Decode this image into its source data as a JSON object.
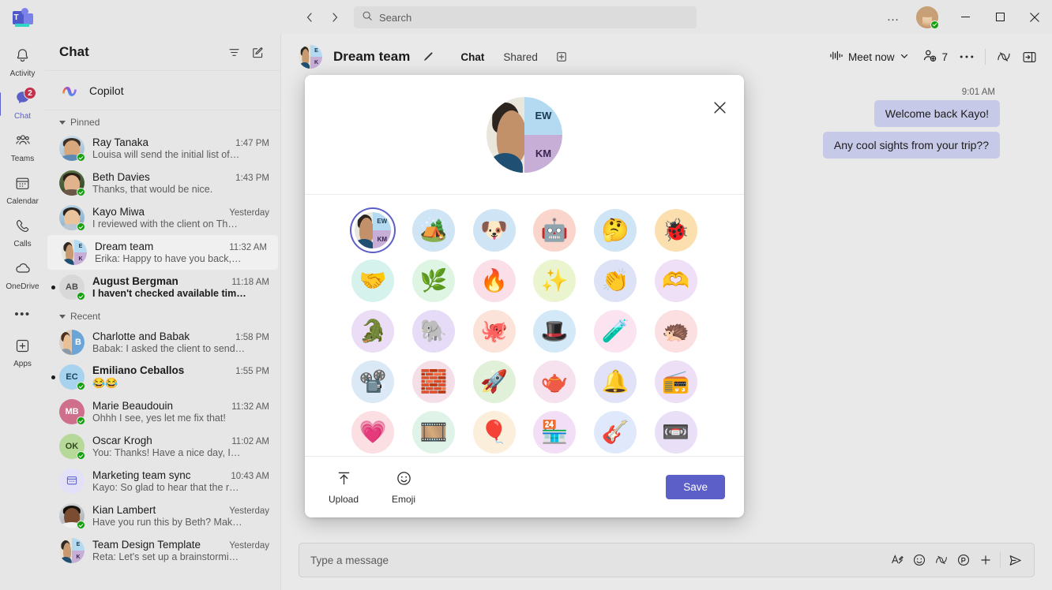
{
  "titlebar": {
    "app_name": "Microsoft Teams",
    "back_icon": "chevron-left-icon",
    "forward_icon": "chevron-right-icon",
    "search_placeholder": "Search",
    "search_value": "",
    "more_label": "…",
    "minimize_label": "–",
    "maximize_label": "☐",
    "close_label": "✕"
  },
  "rail": {
    "items": [
      {
        "label": "Activity",
        "icon": "bell-icon",
        "active": false,
        "badge": ""
      },
      {
        "label": "Chat",
        "icon": "chat-icon",
        "active": true,
        "badge": "2"
      },
      {
        "label": "Teams",
        "icon": "people-icon",
        "active": false,
        "badge": ""
      },
      {
        "label": "Calendar",
        "icon": "calendar-icon",
        "active": false,
        "badge": ""
      },
      {
        "label": "Calls",
        "icon": "phone-icon",
        "active": false,
        "badge": ""
      },
      {
        "label": "OneDrive",
        "icon": "cloud-icon",
        "active": false,
        "badge": ""
      }
    ],
    "more_label": "•••",
    "apps_label": "Apps",
    "apps_icon": "plus-box-icon"
  },
  "chat_list": {
    "title": "Chat",
    "filter_icon": "filter-icon",
    "compose_icon": "compose-icon",
    "copilot_label": "Copilot",
    "groups": [
      {
        "label": "Pinned",
        "items": [
          {
            "name": "Ray Tanaka",
            "time": "1:47 PM",
            "preview": "Louisa will send the initial list of…",
            "unread": false,
            "selected": false,
            "avatar_type": "photo",
            "initials": "RT",
            "color": "#a8c4d8",
            "presence": true
          },
          {
            "name": "Beth Davies",
            "time": "1:43 PM",
            "preview": "Thanks, that would be nice.",
            "unread": false,
            "selected": false,
            "avatar_type": "photo",
            "initials": "BD",
            "color": "#7f9f73",
            "presence": true
          },
          {
            "name": "Kayo Miwa",
            "time": "Yesterday",
            "preview": "I reviewed with the client on Th…",
            "unread": false,
            "selected": false,
            "avatar_type": "photo",
            "initials": "KM",
            "color": "#9fc3dd",
            "presence": true
          },
          {
            "name": "Dream team",
            "time": "11:32 AM",
            "preview": "Erika: Happy to have you back,…",
            "unread": false,
            "selected": true,
            "avatar_type": "group",
            "initials": "DT",
            "color": "#b4a7d6",
            "presence": false
          },
          {
            "name": "August Bergman",
            "time": "11:18 AM",
            "preview": "I haven't checked available tim…",
            "unread": true,
            "selected": false,
            "avatar_type": "initials",
            "initials": "AB",
            "color": "#d6d6d6",
            "presence": true
          }
        ]
      },
      {
        "label": "Recent",
        "items": [
          {
            "name": "Charlotte and Babak",
            "time": "1:58 PM",
            "preview": "Babak: I asked the client to send…",
            "unread": false,
            "selected": false,
            "avatar_type": "group2",
            "initials": "B",
            "color": "#6ba5d7",
            "presence": false
          },
          {
            "name": "Emiliano Ceballos",
            "time": "1:55 PM",
            "preview": "😂😂",
            "unread": true,
            "selected": false,
            "avatar_type": "initials",
            "initials": "EC",
            "color": "#a8d3ef",
            "presence": true
          },
          {
            "name": "Marie Beaudouin",
            "time": "11:32 AM",
            "preview": "Ohhh I see, yes let me fix that!",
            "unread": false,
            "selected": false,
            "avatar_type": "initials",
            "initials": "MB",
            "color": "#d9849c",
            "presence": true
          },
          {
            "name": "Oscar Krogh",
            "time": "11:02 AM",
            "preview": "You: Thanks! Have a nice day, I…",
            "unread": false,
            "selected": false,
            "avatar_type": "initials",
            "initials": "OK",
            "color": "#b6d99a",
            "presence": true
          },
          {
            "name": "Marketing team sync",
            "time": "10:43 AM",
            "preview": "Kayo: So glad to hear that the r…",
            "unread": false,
            "selected": false,
            "avatar_type": "meeting",
            "initials": "MS",
            "color": "#e3e1f7",
            "presence": false
          },
          {
            "name": "Kian Lambert",
            "time": "Yesterday",
            "preview": "Have you run this by Beth? Mak…",
            "unread": false,
            "selected": false,
            "avatar_type": "photo",
            "initials": "KL",
            "color": "#8d6a4f",
            "presence": true
          },
          {
            "name": "Team Design Template",
            "time": "Yesterday",
            "preview": "Reta: Let's set up a brainstormi…",
            "unread": false,
            "selected": false,
            "avatar_type": "group",
            "initials": "TD",
            "color": "#b4a7d6",
            "presence": false
          }
        ]
      }
    ]
  },
  "chat_header": {
    "title": "Dream team",
    "edit_icon": "pencil-icon",
    "tabs": [
      {
        "label": "Chat",
        "active": true
      },
      {
        "label": "Shared",
        "active": false
      }
    ],
    "add_tab_icon": "add-tab-icon",
    "meet_now_label": "Meet now",
    "meet_now_icon": "meet-now-icon",
    "meet_now_chevron": "chevron-down-icon",
    "participants_icon": "add-people-icon",
    "participants_count": "7",
    "more_icon": "more-horizontal-icon",
    "copilot_icon": "copilot-icon",
    "open_pane_icon": "open-side-pane-icon"
  },
  "messages": {
    "timestamp": "9:01 AM",
    "bubbles": [
      {
        "text": "Welcome back Kayo!"
      },
      {
        "text": "Any cool sights from your trip??"
      }
    ]
  },
  "composer": {
    "placeholder": "Type a message",
    "value": "",
    "icons": [
      {
        "name": "format-icon"
      },
      {
        "name": "emoji-icon"
      },
      {
        "name": "copilot-icon"
      },
      {
        "name": "loop-icon"
      },
      {
        "name": "plus-icon"
      },
      {
        "name": "send-icon"
      }
    ]
  },
  "modal": {
    "title_hidden": "",
    "close_icon": "close-icon",
    "selected_avatar": "group-dream-team",
    "group_avatar": {
      "initial_top": "EW",
      "initial_bottom": "KM",
      "top_color": "#b3daf0",
      "bottom_color": "#c6aed7"
    },
    "avatars": [
      {
        "name": "group-dream-team",
        "glyph": "",
        "bg": "#ffffff",
        "selected": true
      },
      {
        "name": "camping-icon",
        "glyph": "🏕️",
        "bg": "#cfe4f5",
        "selected": false
      },
      {
        "name": "dog-face-icon",
        "glyph": "🐶",
        "bg": "#cfe4f5",
        "selected": false
      },
      {
        "name": "robot-icon",
        "glyph": "🤖",
        "bg": "#fad5cb",
        "selected": false
      },
      {
        "name": "thinking-face-icon",
        "glyph": "🤔",
        "bg": "#cfe4f5",
        "selected": false
      },
      {
        "name": "bug-icon",
        "glyph": "🐞",
        "bg": "#fbdfae",
        "selected": false
      },
      {
        "name": "handshake-icon",
        "glyph": "🤝",
        "bg": "#d5f2ec",
        "selected": false
      },
      {
        "name": "leaf-in-hand-icon",
        "glyph": "🌿",
        "bg": "#dff5e3",
        "selected": false
      },
      {
        "name": "hands-flame-icon",
        "glyph": "🔥",
        "bg": "#fbdfe8",
        "selected": false
      },
      {
        "name": "magic-wand-icon",
        "glyph": "✨",
        "bg": "#eaf5cf",
        "selected": false
      },
      {
        "name": "clapping-hands-icon",
        "glyph": "👏",
        "bg": "#dde2f7",
        "selected": false
      },
      {
        "name": "heart-hands-icon",
        "glyph": "🫶",
        "bg": "#efdff7",
        "selected": false
      },
      {
        "name": "crocodile-icon",
        "glyph": "🐊",
        "bg": "#ecddf7",
        "selected": false
      },
      {
        "name": "elephant-icon",
        "glyph": "🐘",
        "bg": "#e6dcf7",
        "selected": false
      },
      {
        "name": "octopus-icon",
        "glyph": "🐙",
        "bg": "#fbe3da",
        "selected": false
      },
      {
        "name": "rabbit-in-hat-icon",
        "glyph": "🎩",
        "bg": "#d3e9f7",
        "selected": false
      },
      {
        "name": "potion-icon",
        "glyph": "🧪",
        "bg": "#fbe3ef",
        "selected": false
      },
      {
        "name": "hedgehog-icon",
        "glyph": "🦔",
        "bg": "#fbdfe1",
        "selected": false
      },
      {
        "name": "movie-camera-icon",
        "glyph": "📽️",
        "bg": "#dbe9f7",
        "selected": false
      },
      {
        "name": "building-blocks-icon",
        "glyph": "🧱",
        "bg": "#f4dfe9",
        "selected": false
      },
      {
        "name": "rocket-icon",
        "glyph": "🚀",
        "bg": "#e1f1d9",
        "selected": false
      },
      {
        "name": "teacup-icon",
        "glyph": "🫖",
        "bg": "#f6e1ee",
        "selected": false
      },
      {
        "name": "bell-icon",
        "glyph": "🔔",
        "bg": "#e1e1f7",
        "selected": false
      },
      {
        "name": "boombox-icon",
        "glyph": "📻",
        "bg": "#eddff5",
        "selected": false
      },
      {
        "name": "heart-icon",
        "glyph": "💗",
        "bg": "#fbdfe3",
        "selected": false
      },
      {
        "name": "film-reel-icon",
        "glyph": "🎞️",
        "bg": "#dff3e8",
        "selected": false
      },
      {
        "name": "hot-air-balloon-icon",
        "glyph": "🎈",
        "bg": "#fbeedb",
        "selected": false
      },
      {
        "name": "storefront-icon",
        "glyph": "🏪",
        "bg": "#f2dff7",
        "selected": false
      },
      {
        "name": "guitar-icon",
        "glyph": "🎸",
        "bg": "#dfe9fb",
        "selected": false
      },
      {
        "name": "video-folder-icon",
        "glyph": "📼",
        "bg": "#e9dff7",
        "selected": false
      }
    ],
    "upload_label": "Upload",
    "upload_icon": "upload-icon",
    "emoji_label": "Emoji",
    "emoji_icon": "emoji-icon",
    "save_label": "Save",
    "accent_color": "#5b5fc7"
  }
}
